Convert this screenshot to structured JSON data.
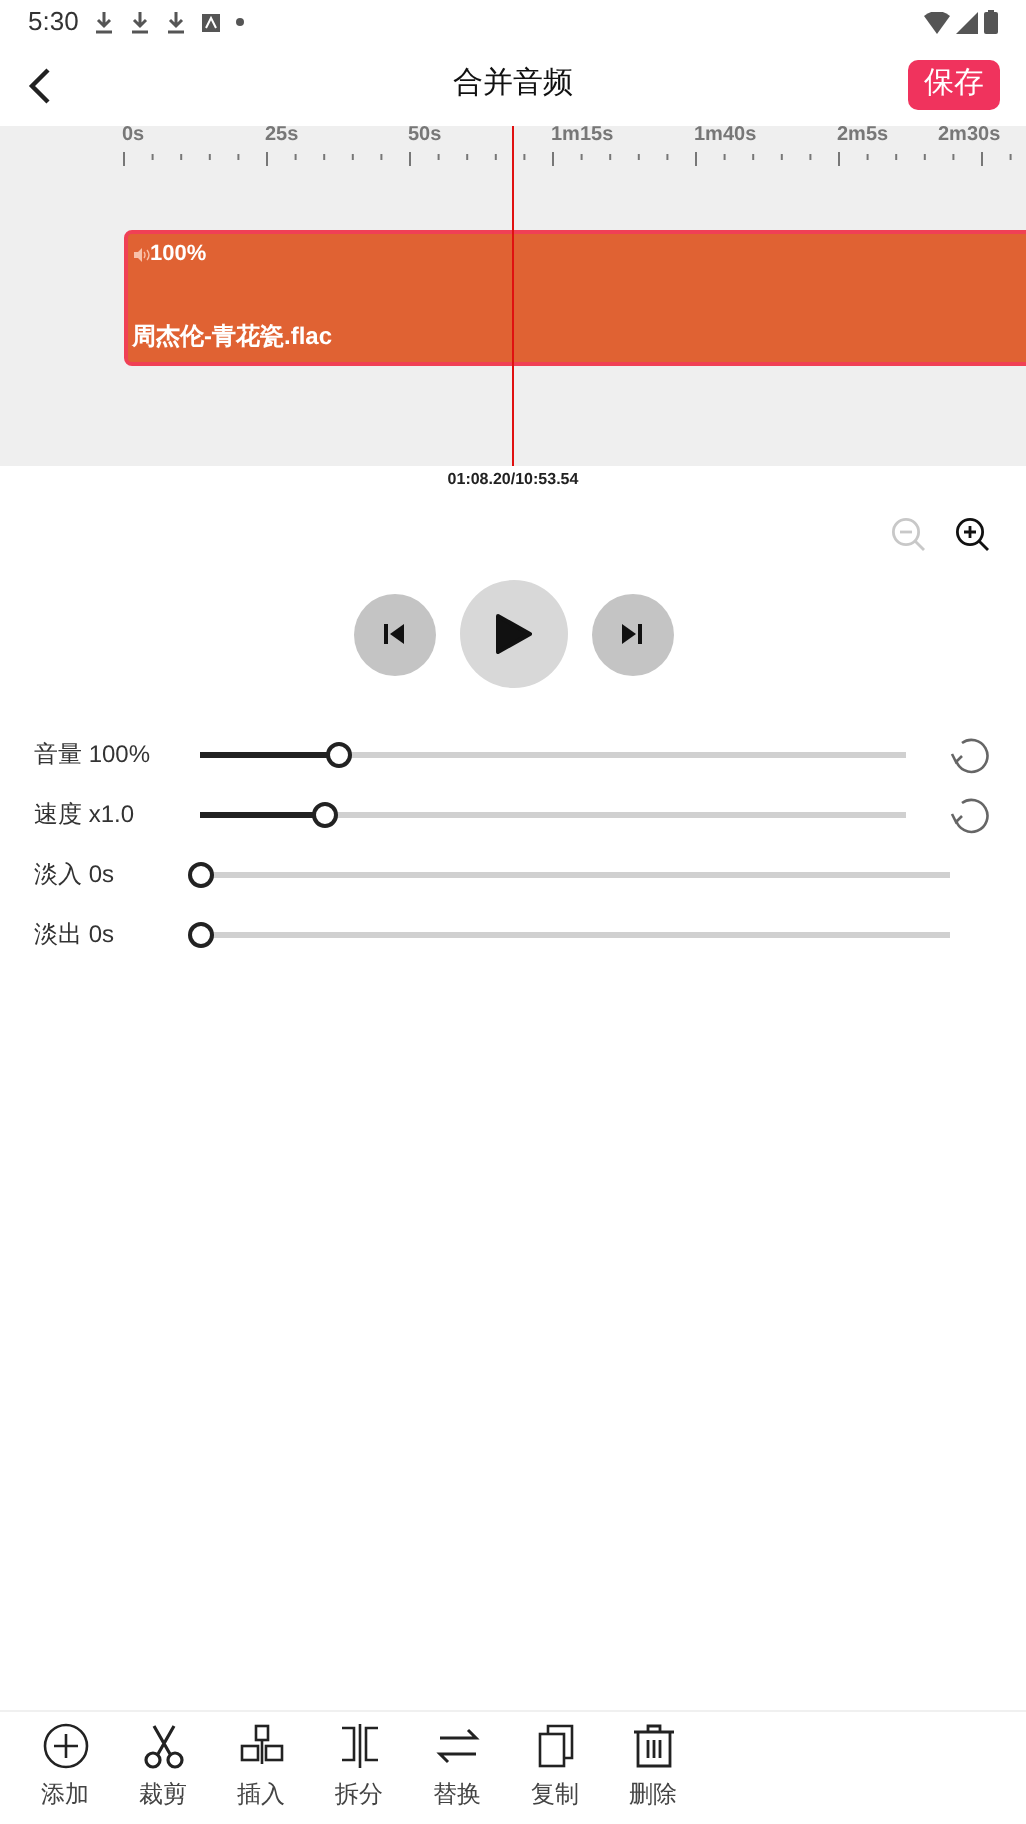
{
  "status_bar": {
    "time": "5:30"
  },
  "header": {
    "title": "合并音频",
    "save_button": "保存"
  },
  "timeline": {
    "ticks": [
      "0s",
      "25s",
      "50s",
      "1m15s",
      "1m40s",
      "2m5s",
      "2m30s"
    ],
    "clip": {
      "volume": "100%",
      "name": "周杰伦-青花瓷.flac"
    },
    "position": "01:08.20/10:53.54"
  },
  "zoom": [
    {
      "disabled": true
    },
    {
      "disabled": false
    }
  ],
  "sliders": [
    {
      "label": "音量 100%",
      "level": 0.2,
      "resettable": true
    },
    {
      "label": "速度 x1.0",
      "level": 0.18,
      "resettable": true
    },
    {
      "label": "淡入 0s",
      "level": 0,
      "resettable": false
    },
    {
      "label": "淡出 0s",
      "level": 0,
      "resettable": false
    }
  ],
  "toolbar": [
    {
      "label": "添加"
    },
    {
      "label": "裁剪"
    },
    {
      "label": "插入"
    },
    {
      "label": "拆分"
    },
    {
      "label": "替换"
    },
    {
      "label": "复制"
    },
    {
      "label": "删除"
    }
  ]
}
